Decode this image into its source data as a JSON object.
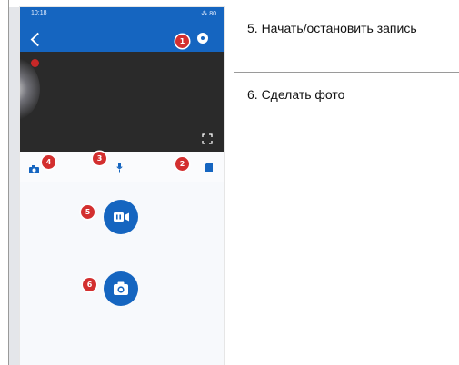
{
  "captions": [
    "5. Начать/остановить запись",
    "6. Сделать фото"
  ],
  "phone": {
    "status_time": "10:18",
    "status_right": "⁂ 80",
    "badges": [
      "1",
      "2",
      "3",
      "4",
      "5",
      "6"
    ],
    "colors": {
      "primary": "#1565c0",
      "badge": "#d32f2f",
      "video_bg": "#2a2a2a"
    },
    "icons": [
      "back-icon",
      "settings-icon",
      "fullscreen-icon",
      "camera-icon",
      "microphone-icon",
      "sd-card-icon",
      "record-video-icon",
      "photo-camera-icon"
    ]
  }
}
